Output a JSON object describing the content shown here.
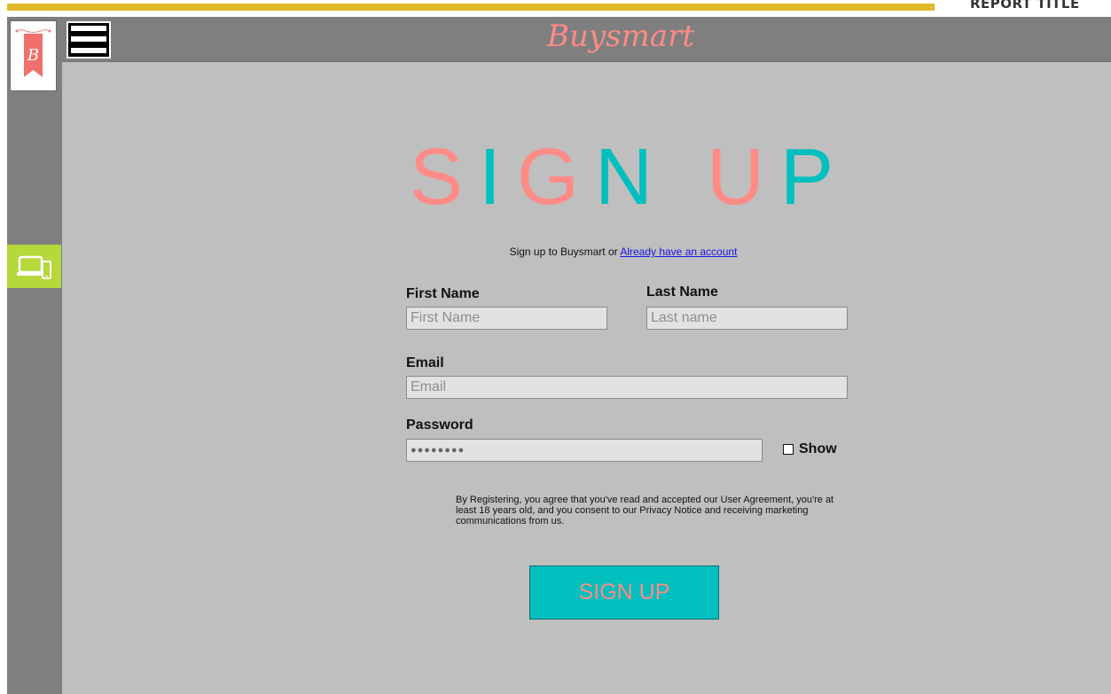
{
  "header": {
    "report_title": "REPORT TITLE",
    "brand": "Buysmart",
    "menu_icon": "hamburger-menu-icon"
  },
  "sidebar": {
    "logo_icon": "buysmart-banner-logo",
    "logo_letter": "B",
    "device_icon": "devices-icon"
  },
  "form": {
    "heading": {
      "letters": [
        {
          "ch": "S",
          "color": "pink"
        },
        {
          "ch": "I",
          "color": "teal"
        },
        {
          "ch": "G",
          "color": "pink"
        },
        {
          "ch": "N",
          "color": "teal"
        },
        {
          "ch": " ",
          "color": "teal"
        },
        {
          "ch": "U",
          "color": "pink"
        },
        {
          "ch": "P",
          "color": "teal"
        }
      ]
    },
    "subline_text": "Sign up to Buysmart or ",
    "subline_link": "Already have an account",
    "first_name": {
      "label": "First Name",
      "placeholder": "First Name"
    },
    "last_name": {
      "label": "Last Name",
      "placeholder": "Last name"
    },
    "email": {
      "label": "Email",
      "placeholder": "Email"
    },
    "password": {
      "label": "Password",
      "value": "●●●●●●●●"
    },
    "show_label": "Show",
    "show_checked": false,
    "terms": "By Registering, you agree that you've read and accepted our User Agreement, you're at least 18 years old, and you consent to our Privacy Notice and receiving marketing communications from us.",
    "submit_label": "SIGN UP"
  },
  "colors": {
    "accent_gold": "#e1b92a",
    "brand_pink": "#ff8b86",
    "brand_teal": "#00bfbf",
    "chrome_gray": "#7f7f7f",
    "content_gray": "#bfbfbf",
    "device_tab_green": "#b5d93a"
  }
}
